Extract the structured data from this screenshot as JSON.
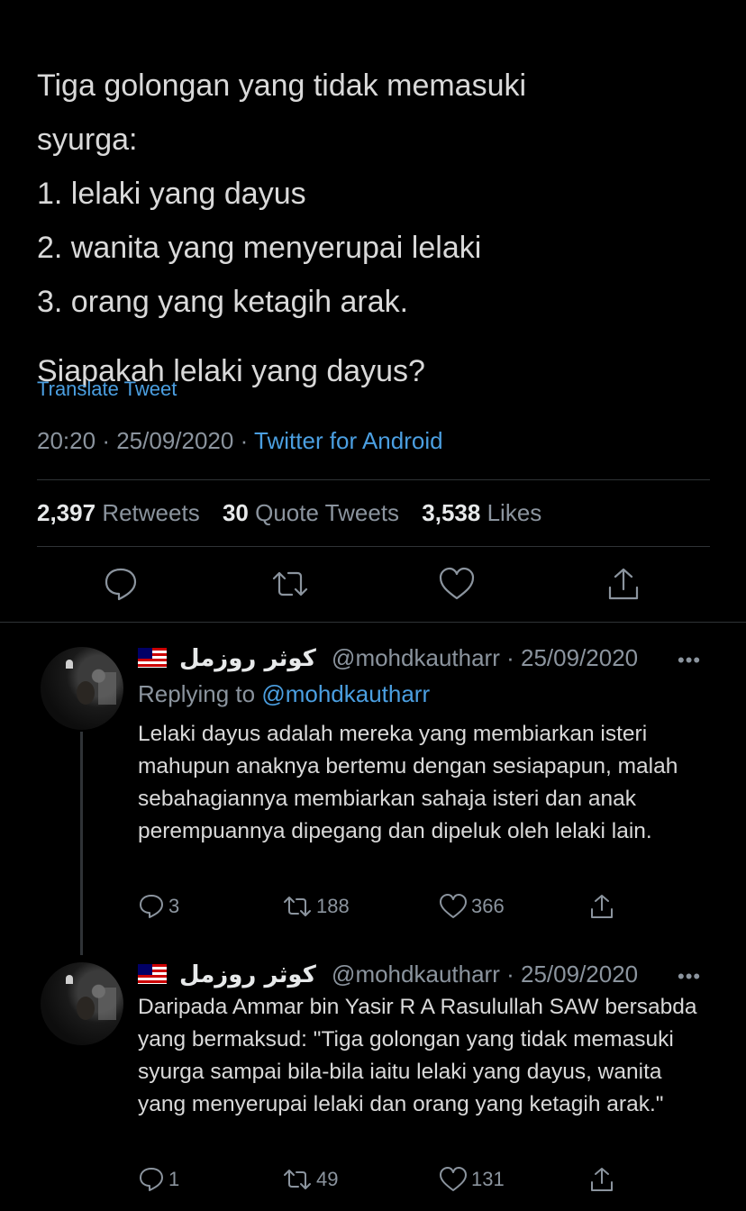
{
  "tweet": {
    "text": "Tiga golongan yang tidak memasuki\nsyurga:\n1. lelaki yang dayus\n2. wanita yang menyerupai lelaki\n3. orang yang ketagih arak.",
    "question": "Siapakah lelaki yang dayus?",
    "translate": "Translate Tweet",
    "time": "20:20",
    "date": "25/09/2020",
    "separator": "·",
    "source": "Twitter for Android",
    "stats": {
      "retweets_count": "2,397",
      "retweets_label": "Retweets",
      "quotes_count": "30",
      "quotes_label": "Quote Tweets",
      "likes_count": "3,538",
      "likes_label": "Likes"
    },
    "actions": [
      "reply-icon",
      "retweet-icon",
      "like-icon",
      "share-icon"
    ]
  },
  "replies": [
    {
      "name": "كوثر روزمل",
      "handle": "@mohdkautharr",
      "separator": "·",
      "date": "25/09/2020",
      "more": "•••",
      "replying_prefix": "Replying to",
      "replying_handle": "@mohdkautharr",
      "text": "Lelaki dayus adalah mereka yang membiarkan isteri mahupun anaknya bertemu dengan sesiapapun, malah sebahagiannya membiarkan sahaja isteri dan anak perempuannya dipegang dan dipeluk oleh lelaki lain.",
      "reply_count": "3",
      "retweet_count": "188",
      "like_count": "366"
    },
    {
      "name": "كوثر روزمل",
      "handle": "@mohdkautharr",
      "separator": "·",
      "date": "25/09/2020",
      "more": "•••",
      "text": "Daripada Ammar bin Yasir R A Rasulullah SAW bersabda yang bermaksud: \"Tiga golongan yang tidak memasuki syurga sampai bila-bila iaitu lelaki yang dayus, wanita yang menyerupai lelaki dan orang yang ketagih arak.\"",
      "reply_count": "1",
      "retweet_count": "49",
      "like_count": "131"
    }
  ],
  "colors": {
    "background": "#000000",
    "text": "#d9d9d9",
    "muted": "#8b949e",
    "link": "#4b9fe1",
    "divider": "#2f3336"
  }
}
